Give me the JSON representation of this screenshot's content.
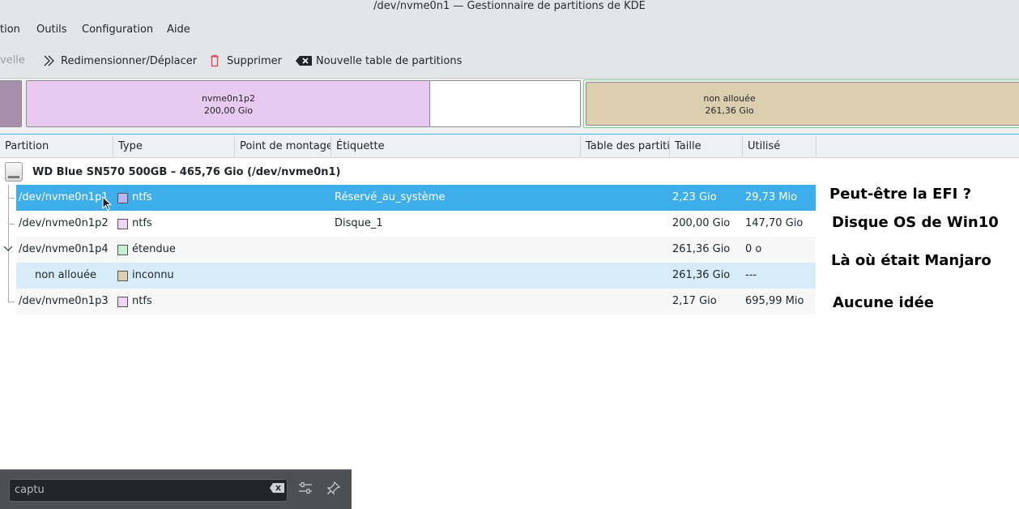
{
  "window": {
    "title": "/dev/nvme0n1 — Gestionnaire de partitions de KDE"
  },
  "menubar": {
    "items": [
      "tion",
      "Outils",
      "Configuration",
      "Aide"
    ]
  },
  "toolbar": {
    "new_label": "velle",
    "resize_label": "Redimensionner/Déplacer",
    "delete_label": "Supprimer",
    "new_table_label": "Nouvelle table de partitions"
  },
  "partition_bar": {
    "p2_name": "nvme0n1p2",
    "p2_size": "200,00 Gio",
    "unalloc_name": "non allouée",
    "unalloc_size": "261,36 Gio",
    "colors": {
      "ntfs": "#e8c9f0",
      "unallocated": "#dccfaf",
      "reserved": "#a58fab",
      "extended": "#c6f0cf"
    }
  },
  "table": {
    "headers": [
      "Partition",
      "Type",
      "Point de montage",
      "Étiquette",
      "Table des partiti",
      "Taille",
      "Utilisé"
    ],
    "device_label": "WD Blue SN570 500GB – 465,76 Gio (/dev/nvme0n1)",
    "rows": [
      {
        "partition": "/dev/nvme0n1p1",
        "type": "ntfs",
        "label": "Réservé_au_système",
        "size": "2,23 Gio",
        "used": "29,73 Mio",
        "swatch": "#b6b6f0"
      },
      {
        "partition": "/dev/nvme0n1p2",
        "type": "ntfs",
        "label": "Disque_1",
        "size": "200,00 Gio",
        "used": "147,70 Gio",
        "swatch": "#f0d4f4"
      },
      {
        "partition": "/dev/nvme0n1p4",
        "type": "étendue",
        "label": "",
        "size": "261,36 Gio",
        "used": "0 o",
        "swatch": "#c6f0cf"
      },
      {
        "partition": "non allouée",
        "type": "inconnu",
        "label": "",
        "size": "261,36 Gio",
        "used": "---",
        "swatch": "#dccfaf"
      },
      {
        "partition": "/dev/nvme0n1p3",
        "type": "ntfs",
        "label": "",
        "size": "2,17 Gio",
        "used": "695,99 Mio",
        "swatch": "#f0d4f4"
      }
    ]
  },
  "annotations": [
    "Peut-être la EFI ?",
    "Disque OS de Win10",
    "Là où était Manjaro",
    "Aucune idée"
  ],
  "krunner": {
    "query": "captu"
  }
}
